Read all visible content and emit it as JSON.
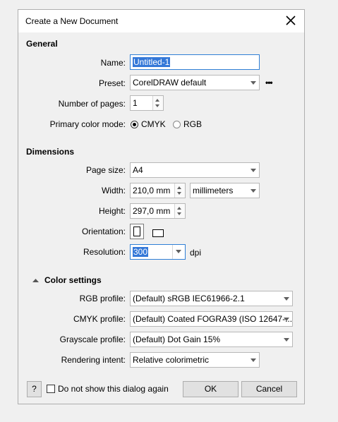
{
  "dialog": {
    "title": "Create a New Document"
  },
  "general": {
    "section_title": "General",
    "name_label": "Name:",
    "name_value": "Untitled-1",
    "preset_label": "Preset:",
    "preset_value": "CorelDRAW default",
    "more_label": "•••",
    "pages_label": "Number of pages:",
    "pages_value": "1",
    "color_mode_label": "Primary color mode:",
    "color_modes": [
      "CMYK",
      "RGB"
    ],
    "color_mode_selected": "CMYK"
  },
  "dimensions": {
    "section_title": "Dimensions",
    "page_size_label": "Page size:",
    "page_size_value": "A4",
    "width_label": "Width:",
    "width_value": "210,0 mm",
    "units_value": "millimeters",
    "height_label": "Height:",
    "height_value": "297,0 mm",
    "orientation_label": "Orientation:",
    "resolution_label": "Resolution:",
    "resolution_value": "300",
    "resolution_unit": "dpi"
  },
  "color_settings": {
    "section_title": "Color settings",
    "rgb_label": "RGB profile:",
    "rgb_value": "(Default) sRGB IEC61966-2.1",
    "cmyk_label": "CMYK profile:",
    "cmyk_value": "(Default) Coated FOGRA39 (ISO 12647-...",
    "grayscale_label": "Grayscale profile:",
    "grayscale_value": "(Default) Dot Gain 15%",
    "intent_label": "Rendering intent:",
    "intent_value": "Relative colorimetric"
  },
  "footer": {
    "help_label": "?",
    "dont_show_label": "Do not show this dialog again",
    "ok_label": "OK",
    "cancel_label": "Cancel"
  }
}
